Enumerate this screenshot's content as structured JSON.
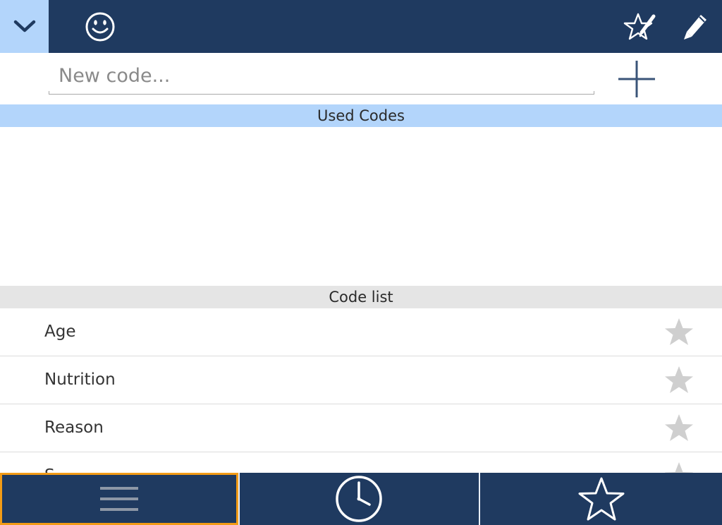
{
  "topbar": {
    "background": "#1f3a60",
    "collapse_background": "#b3d5fb",
    "icons": [
      "chevron-down-icon",
      "smiley-icon",
      "star-edit-icon",
      "pencil-icon"
    ]
  },
  "new_code": {
    "placeholder": "New code...",
    "value": "",
    "add_icon": "plus-icon"
  },
  "sections": {
    "used_codes": "Used Codes",
    "code_list": "Code list"
  },
  "codes": [
    {
      "label": "Age",
      "starred": false
    },
    {
      "label": "Nutrition",
      "starred": false
    },
    {
      "label": "Reason",
      "starred": false
    },
    {
      "label": "S...",
      "starred": false
    }
  ],
  "bottom_tabs": {
    "selected": "list",
    "highlight_color": "#f29b16",
    "icons": [
      "menu-icon",
      "clock-icon",
      "star-icon"
    ]
  }
}
